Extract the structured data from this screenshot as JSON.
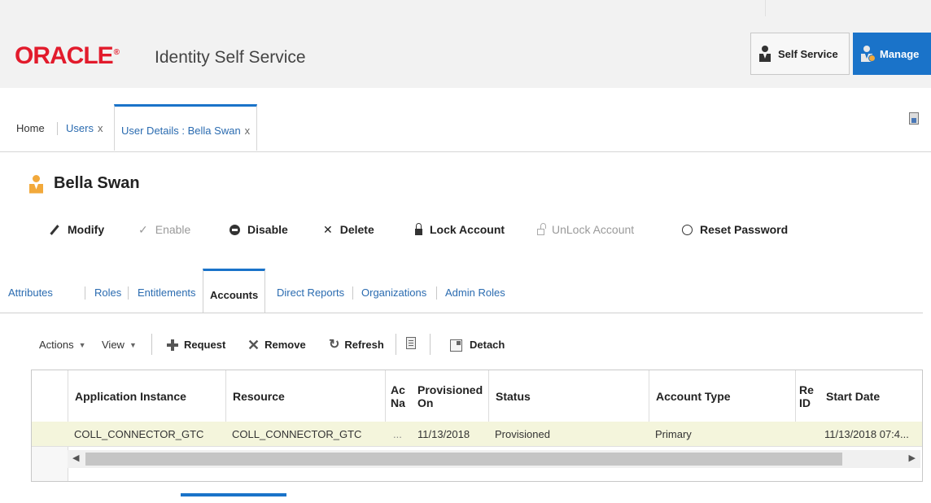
{
  "header": {
    "logo": "ORACLE",
    "product": "Identity Self Service",
    "self_service": "Self Service",
    "manage": "Manage"
  },
  "tabs": {
    "home": "Home",
    "users": "Users",
    "user_details": "User Details : Bella Swan",
    "close": "x"
  },
  "user": {
    "name": "Bella Swan"
  },
  "actions": {
    "modify": "Modify",
    "enable": "Enable",
    "disable": "Disable",
    "delete": "Delete",
    "lock": "Lock Account",
    "unlock": "UnLock Account",
    "reset": "Reset Password"
  },
  "subtabs": [
    "Attributes",
    "Roles",
    "Entitlements",
    "Accounts",
    "Direct Reports",
    "Organizations",
    "Admin Roles"
  ],
  "toolbar": {
    "actions": "Actions",
    "view": "View",
    "request": "Request",
    "remove": "Remove",
    "refresh": "Refresh",
    "detach": "Detach"
  },
  "table": {
    "columns": {
      "app_instance": "Application Instance",
      "resource": "Resource",
      "acct_name_1": "Ac",
      "acct_name_2": "Na",
      "provisioned_1": "Provisioned",
      "provisioned_2": "On",
      "status": "Status",
      "account_type": "Account Type",
      "req_id_1": "Re",
      "req_id_2": "ID",
      "start_date": "Start Date"
    },
    "rows": [
      {
        "app_instance": "COLL_CONNECTOR_GTC",
        "resource": "COLL_CONNECTOR_GTC",
        "account_name": "...",
        "provisioned_on": "11/13/2018",
        "status": "Provisioned",
        "account_type": "Primary",
        "start_date": "11/13/2018 07:4..."
      }
    ]
  }
}
